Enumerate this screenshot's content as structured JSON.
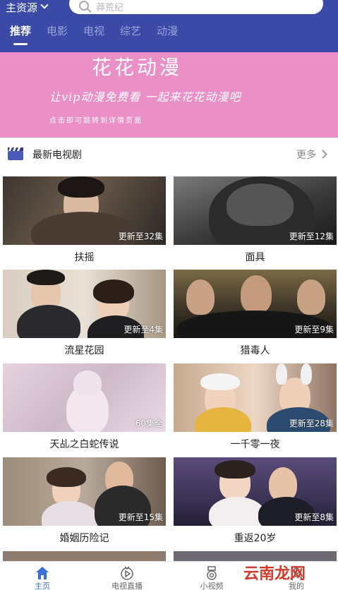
{
  "header": {
    "source_label": "主资源",
    "search_placeholder": "莽荒纪",
    "tabs": [
      {
        "label": "推荐",
        "active": true
      },
      {
        "label": "电影",
        "active": false
      },
      {
        "label": "电视",
        "active": false
      },
      {
        "label": "综艺",
        "active": false
      },
      {
        "label": "动漫",
        "active": false
      }
    ],
    "accent": "#3a4aa6"
  },
  "banner": {
    "title": "花花动漫",
    "line2": "让vip动漫免费看 一起来花花动漫吧",
    "line3": "点击即可跳转到详情页面",
    "bg": "#eb8fc7"
  },
  "section": {
    "title": "最新电视剧",
    "more_label": "更多",
    "icon": "clapperboard-icon"
  },
  "cards": [
    {
      "title": "扶摇",
      "badge": "更新至32集"
    },
    {
      "title": "面具",
      "badge": "更新至12集"
    },
    {
      "title": "流星花园",
      "badge": "更新至4集"
    },
    {
      "title": "猎毒人",
      "badge": "更新至9集"
    },
    {
      "title": "天乩之白蛇传说",
      "badge": "60集全"
    },
    {
      "title": "一千零一夜",
      "badge": "更新至28集"
    },
    {
      "title": "婚姻历险记",
      "badge": "更新至15集"
    },
    {
      "title": "重返20岁",
      "badge": "更新至8集"
    }
  ],
  "bottom_nav": [
    {
      "label": "主页",
      "icon": "home-icon",
      "active": true
    },
    {
      "label": "电视直播",
      "icon": "tv-live-icon",
      "active": false
    },
    {
      "label": "小视频",
      "icon": "short-video-icon",
      "active": false
    },
    {
      "label": "我的",
      "icon": "profile-icon",
      "active": false
    }
  ],
  "watermark": "云南龙网"
}
